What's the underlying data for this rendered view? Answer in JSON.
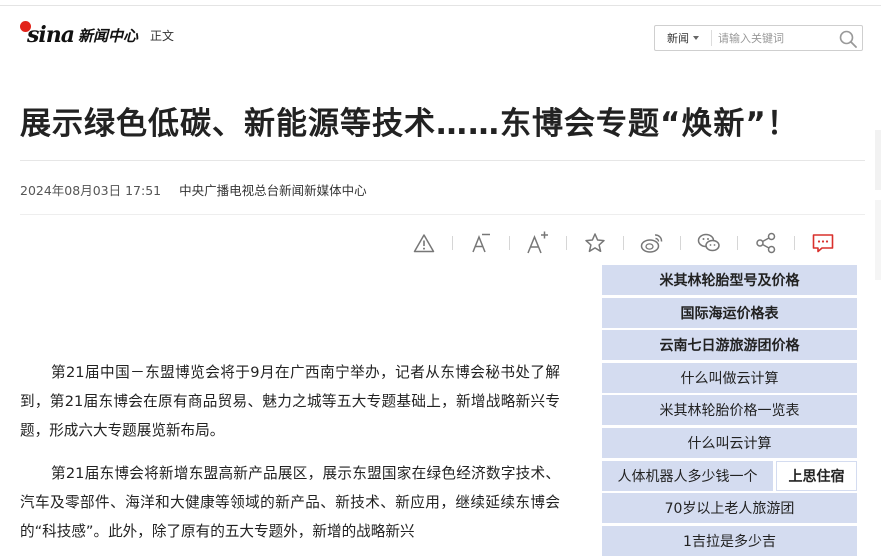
{
  "header": {
    "logo_text": "sina",
    "logo_news": "新闻中心",
    "section": "正文",
    "search": {
      "category": "新闻",
      "placeholder": "请输入关键词"
    }
  },
  "article": {
    "title": "展示绿色低碳、新能源等技术……东博会专题“焕新”！",
    "datetime": "2024年08月03日 17:51",
    "source": "中央广播电视总台新闻新媒体中心",
    "paragraphs": [
      "第21届中国－东盟博览会将于9月在广西南宁举办，记者从东博会秘书处了解到，第21届东博会在原有商品贸易、魅力之城等五大专题基础上，新增战略新兴专题，形成六大专题展览新布局。",
      "第21届东博会将新增东盟高新产品展区，展示东盟国家在绿色经济数字技术、汽车及零部件、海洋和大健康等领域的新产品、新技术、新应用，继续延续东博会的“科技感”。此外，除了原有的五大专题外，新增的战略新兴"
    ]
  },
  "tools": [
    {
      "icon": "report-warning-icon"
    },
    {
      "icon": "font-decrease-icon"
    },
    {
      "icon": "font-increase-icon"
    },
    {
      "icon": "favorite-star-icon"
    },
    {
      "icon": "weibo-icon"
    },
    {
      "icon": "wechat-icon"
    },
    {
      "icon": "share-icon"
    },
    {
      "icon": "comment-icon",
      "color": "#d9302c"
    }
  ],
  "sidebar": {
    "items": [
      {
        "label": "米其林轮胎型号及价格",
        "bold": true
      },
      {
        "label": "国际海运价格表",
        "bold": true
      },
      {
        "label": "云南七日游旅游团价格",
        "bold": true
      },
      {
        "label": "什么叫做云计算",
        "bold": false
      },
      {
        "label": "米其林轮胎价格一览表",
        "bold": false
      },
      {
        "label": "什么叫云计算",
        "bold": false
      },
      {
        "label": "人体机器人多少钱一个",
        "bold": false,
        "button": "上思住宿"
      },
      {
        "label": "70岁以上老人旅游团",
        "bold": false
      },
      {
        "label": "1吉拉是多少吉",
        "bold": false
      }
    ]
  },
  "colors": {
    "accent": "#e2231a",
    "sidebar_bg": "#d4dcf0",
    "text": "#222222"
  }
}
